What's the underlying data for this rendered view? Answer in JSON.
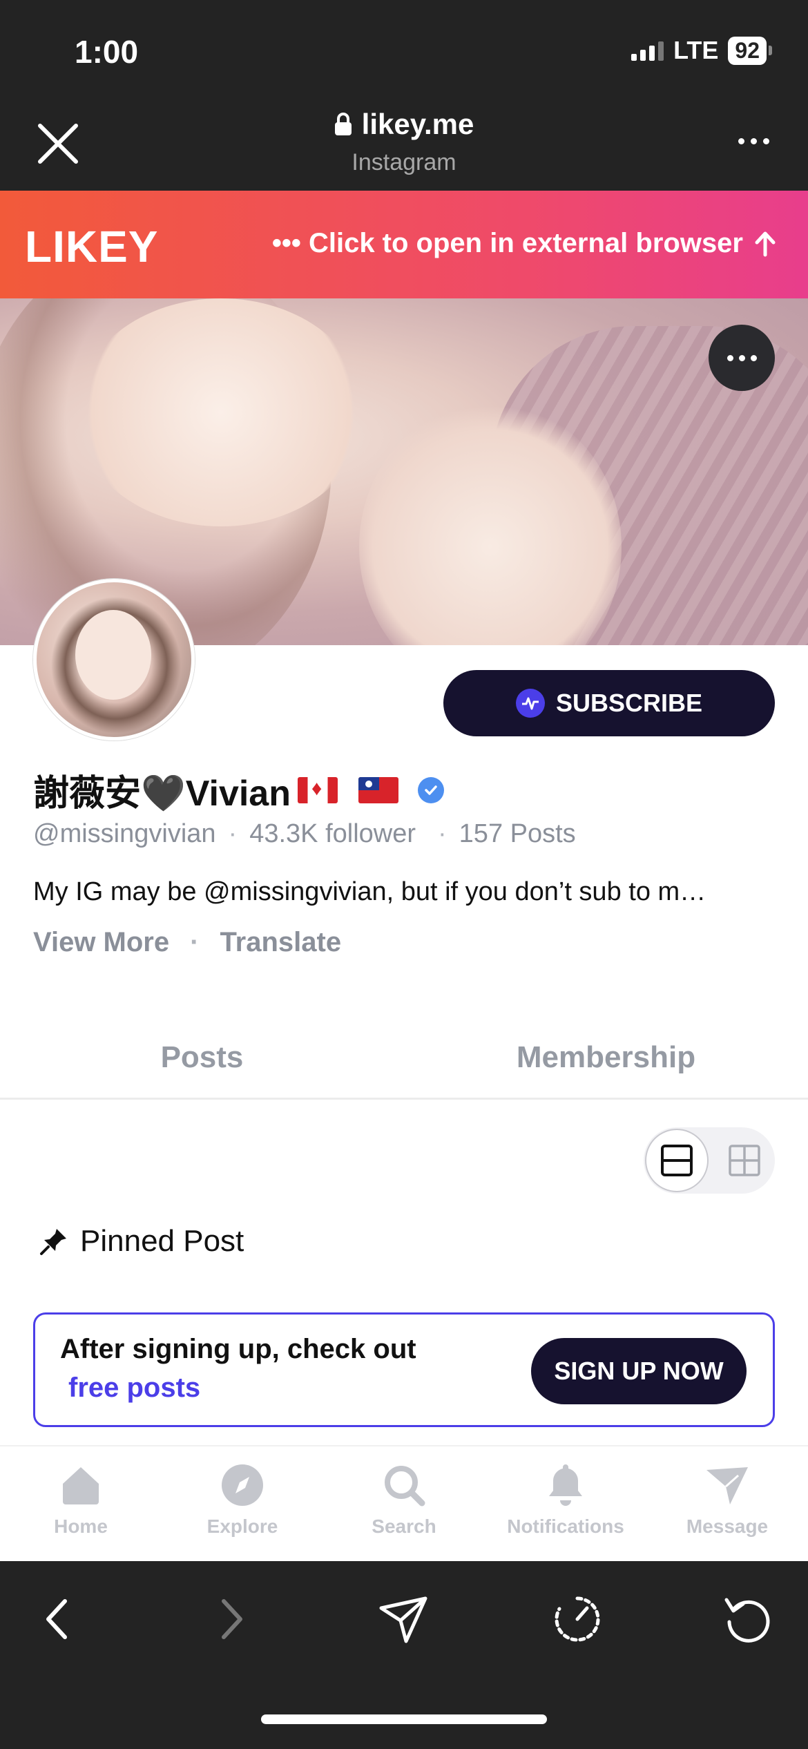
{
  "status_bar": {
    "time": "1:00",
    "network": "LTE",
    "battery": "92"
  },
  "browser": {
    "url": "likey.me",
    "subtitle": "Instagram"
  },
  "banner": {
    "logo": "LIKEY",
    "cta": "••• Click to open in external browser"
  },
  "profile": {
    "name": "謝薇安🖤Vivian",
    "handle": "@missingvivian",
    "followers": "43.3K follower",
    "posts": "157 Posts",
    "bio": "My IG may be @missingvivian, but if you don’t sub to m…",
    "view_more": "View More",
    "translate": "Translate",
    "subscribe_label": "SUBSCRIBE"
  },
  "tabs": [
    {
      "label": "Posts"
    },
    {
      "label": "Membership"
    }
  ],
  "pinned_label": "Pinned Post",
  "signup": {
    "line1": "After signing up, check out",
    "line2": "free posts",
    "button": "SIGN UP NOW"
  },
  "bottom_nav": [
    {
      "label": "Home",
      "icon": "home-icon"
    },
    {
      "label": "Explore",
      "icon": "compass-icon"
    },
    {
      "label": "Search",
      "icon": "search-icon"
    },
    {
      "label": "Notifications",
      "icon": "bell-icon"
    },
    {
      "label": "Message",
      "icon": "send-icon"
    }
  ],
  "colors": {
    "accent": "#4b3ee8",
    "dark_button": "#16122f",
    "banner_start": "#f25a3a",
    "banner_end": "#e83e8c",
    "muted": "#8a8f99"
  }
}
